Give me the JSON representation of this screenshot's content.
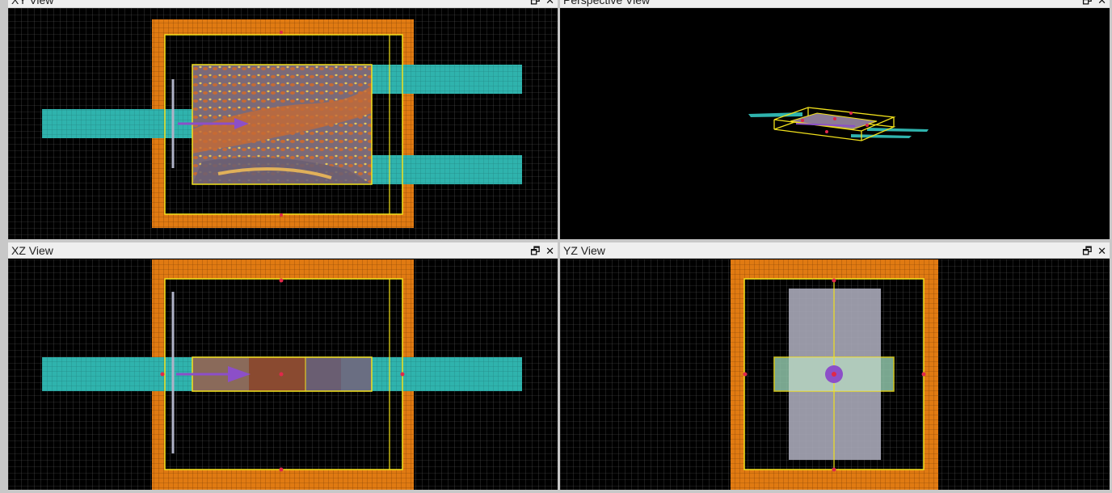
{
  "views": {
    "xy": {
      "title": "XY View"
    },
    "perspective": {
      "title": "Perspective View"
    },
    "xz": {
      "title": "XZ View"
    },
    "yz": {
      "title": "YZ View"
    }
  },
  "controls": {
    "restore_symbol": "🗗",
    "close_symbol": "✕"
  },
  "colors": {
    "background": "#000000",
    "grid": "#5a5a5a",
    "pml": "#e07a12",
    "sim_region": "#f2e21c",
    "waveguide": "#2fb3ad",
    "source": "#8c4fc8",
    "monitor": "#b0b3c8",
    "marker": "#e0284a"
  },
  "icons": {
    "restore": "restore-window-icon",
    "close": "close-icon"
  }
}
